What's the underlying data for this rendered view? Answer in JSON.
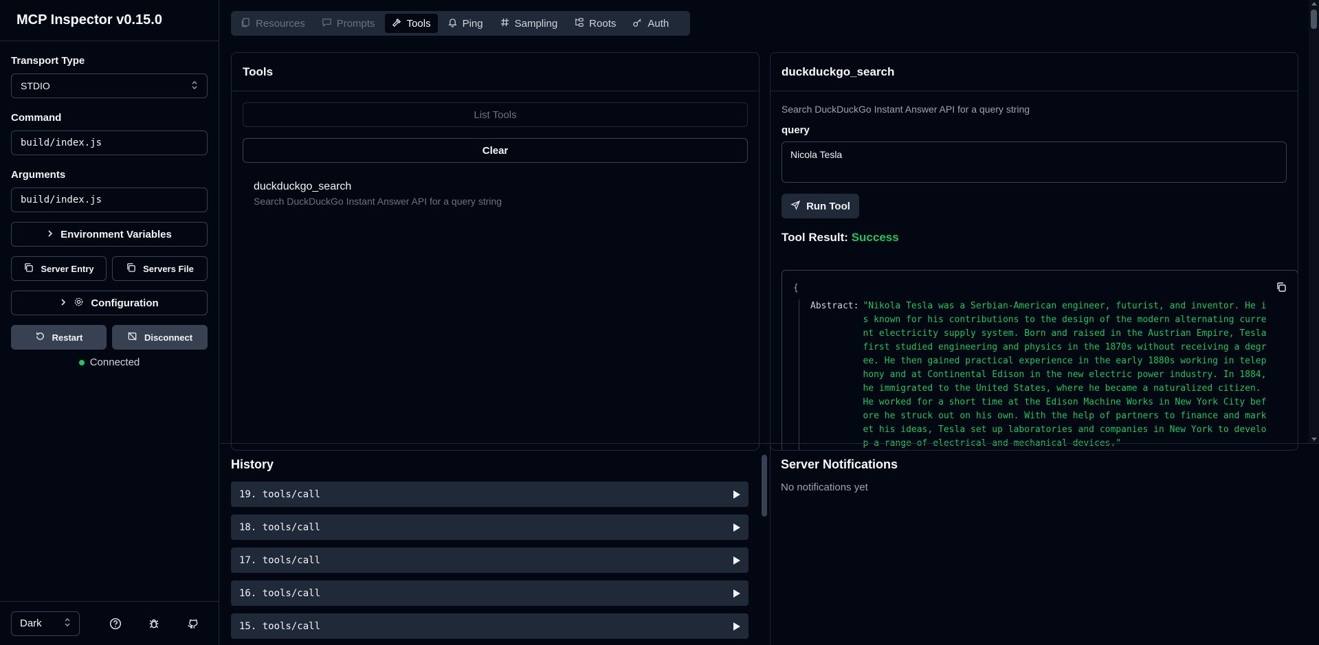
{
  "app": {
    "title": "MCP Inspector v0.15.0"
  },
  "sidebar": {
    "transport_label": "Transport Type",
    "transport_value": "STDIO",
    "command_label": "Command",
    "command_value": "build/index.js",
    "arguments_label": "Arguments",
    "arguments_value": "build/index.js",
    "env_vars_button": "Environment Variables",
    "server_entry_button": "Server Entry",
    "servers_file_button": "Servers File",
    "configuration_button": "Configuration",
    "restart_button": "Restart",
    "disconnect_button": "Disconnect",
    "status": "Connected",
    "theme_value": "Dark"
  },
  "tabs": [
    {
      "label": "Resources",
      "icon": "files-icon",
      "state": "disabled"
    },
    {
      "label": "Prompts",
      "icon": "message-icon",
      "state": "disabled"
    },
    {
      "label": "Tools",
      "icon": "hammer-icon",
      "state": "active"
    },
    {
      "label": "Ping",
      "icon": "bell-icon",
      "state": "normal"
    },
    {
      "label": "Sampling",
      "icon": "hash-icon",
      "state": "normal"
    },
    {
      "label": "Roots",
      "icon": "folder-tree-icon",
      "state": "normal"
    },
    {
      "label": "Auth",
      "icon": "key-icon",
      "state": "normal"
    }
  ],
  "tools_panel": {
    "title": "Tools",
    "list_button": "List Tools",
    "clear_button": "Clear",
    "items": [
      {
        "name": "duckduckgo_search",
        "description": "Search DuckDuckGo Instant Answer API for a query string"
      }
    ]
  },
  "tool_detail": {
    "title": "duckduckgo_search",
    "description": "Search DuckDuckGo Instant Answer API for a query string",
    "param_label": "query",
    "param_value": "Nicola Tesla",
    "run_button": "Run Tool",
    "result_label": "Tool Result:",
    "result_status": "Success",
    "result_json": {
      "open_brace": "{",
      "key": "Abstract:",
      "value": "\"Nikola Tesla was a Serbian-American engineer, futurist, and inventor. He is known for his contributions to the design of the modern alternating current electricity supply system. Born and raised in the Austrian Empire, Tesla first studied engineering and physics in the 1870s without receiving a degree. He then gained practical experience in the early 1880s working in telephony and at Continental Edison in the new electric power industry. In 1884, he immigrated to the United States, where he became a naturalized citizen. He worked for a short time at the Edison Machine Works in New York City before he struck out on his own. With the help of partners to finance and market his ideas, Tesla set up laboratories and companies in New York to develop a range of electrical and mechanical devices.\""
    }
  },
  "history": {
    "title": "History",
    "items": [
      "19. tools/call",
      "18. tools/call",
      "17. tools/call",
      "16. tools/call",
      "15. tools/call"
    ]
  },
  "notifications": {
    "title": "Server Notifications",
    "empty_text": "No notifications yet"
  },
  "colors": {
    "background": "#030712",
    "success": "#22c55e",
    "border": "#1f2937"
  }
}
